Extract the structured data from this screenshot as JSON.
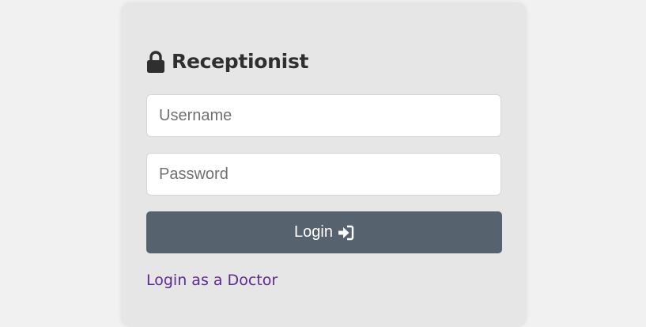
{
  "login_card": {
    "title": "Receptionist",
    "lock_icon": "lock-icon",
    "username_placeholder": "Username",
    "username_value": "",
    "password_placeholder": "Password",
    "password_value": "",
    "login_label": "Login",
    "login_icon": "sign-in-icon",
    "alt_login_link": "Login as a Doctor"
  },
  "colors": {
    "page_background": "#f1f1f1",
    "card_background": "#e6e6e6",
    "button_background": "#56626d",
    "link_color": "#5c2b8f",
    "title_color": "#2f2f2f"
  }
}
